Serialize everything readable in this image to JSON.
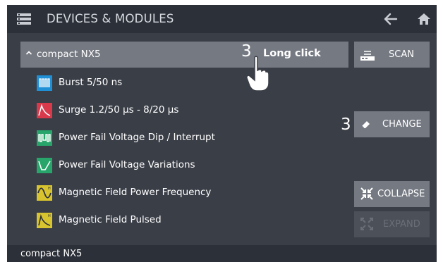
{
  "header": {
    "title": "DEVICES & MODULES",
    "menu_icon": "device-list-icon",
    "back_icon": "arrow-left-icon",
    "home_icon": "home-icon"
  },
  "group": {
    "name": "compact NX5",
    "expanded": true,
    "callout_number": "3",
    "callout_text": "Long click"
  },
  "modules": [
    {
      "label": "Burst 5/50 ns",
      "icon": "burst-icon",
      "color": "#1f8fd6"
    },
    {
      "label": "Surge 1.2/50 µs - 8/20 µs",
      "icon": "surge-icon",
      "color": "#d83a4c"
    },
    {
      "label": "Power Fail Voltage Dip / Interrupt",
      "icon": "power-fail-dip-icon",
      "color": "#27a56a"
    },
    {
      "label": "Power Fail Voltage Variations",
      "icon": "power-fail-variations-icon",
      "color": "#27a56a"
    },
    {
      "label": "Magnetic Field Power Frequency",
      "icon": "magnetic-field-frequency-icon",
      "color": "#d8c42e"
    },
    {
      "label": "Magnetic Field Pulsed",
      "icon": "magnetic-field-pulsed-icon",
      "color": "#d8c42e"
    }
  ],
  "buttons": {
    "scan": "SCAN",
    "change": "CHANGE",
    "change_callout": "3",
    "collapse": "COLLAPSE",
    "expand": "EXPAND",
    "expand_enabled": false
  },
  "status": {
    "text": "compact NX5"
  },
  "colors": {
    "screen_bg": "#3a3e47",
    "bar_bg": "#2c3038",
    "button_bg": "#757982"
  }
}
